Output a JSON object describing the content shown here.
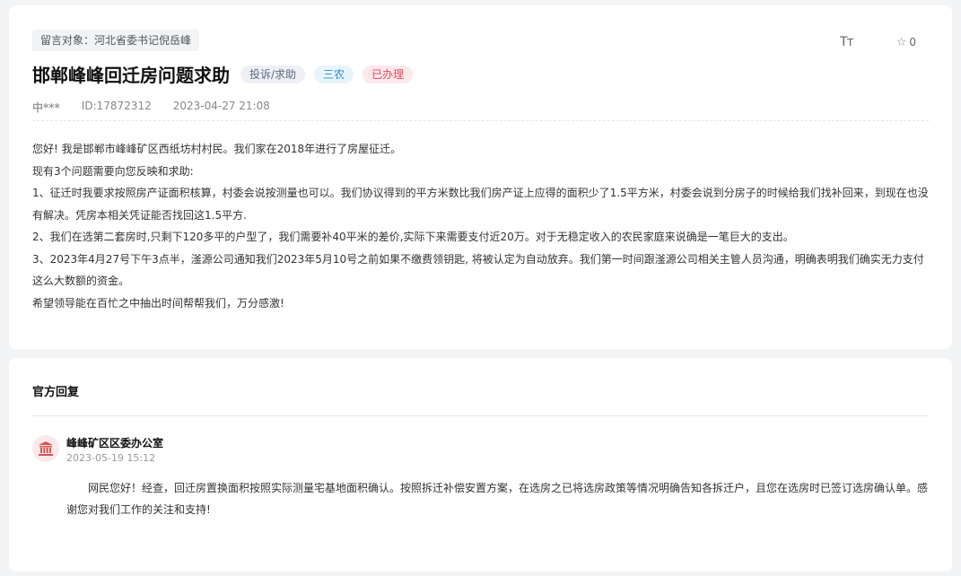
{
  "message": {
    "target_tag": "留言对象：河北省委书记倪岳峰",
    "tools": {
      "font_size_icon": "Tт",
      "star_count": "0",
      "star_icon": "star-outline"
    },
    "title": "邯郸峰峰回迁房问题求助",
    "tags": {
      "type": "投诉/求助",
      "category": "三农",
      "status": "已办理"
    },
    "tag_colors": {
      "type": "#5b6a85",
      "category": "#2e8ccd",
      "status": "#e04a5c"
    },
    "author": "中***",
    "id": "ID:17872312",
    "time": "2023-04-27 21:08",
    "content": [
      "您好! 我是邯郸市峰峰矿区西纸坊村村民。我们家在2018年进行了房屋征迁。",
      "现有3个问题需要向您反映和求助:",
      "1、征迁时我要求按照房产证面积核算，村委会说按测量也可以。我们协议得到的平方米数比我们房产证上应得的面积少了1.5平方米，村委会说到分房子的时候给我们找补回来，到现在也没有解决。凭房本相关凭证能否找回这1.5平方.",
      "2、我们在选第二套房时,只剩下120多平的户型了，我们需要补40平米的差价,实际下来需要支付近20万。对于无稳定收入的农民家庭来说确是一笔巨大的支出。",
      "3、2023年4月27号下午3点半，滏源公司通知我们2023年5月10号之前如果不缴费领钥匙, 将被认定为自动放弃。我们第一时间跟滏源公司相关主管人员沟通，明确表明我们确实无力支付这么大数额的资金。",
      "希望领导能在百忙之中抽出时间帮帮我们，万分感激!"
    ]
  },
  "reply": {
    "heading": "官方回复",
    "office": "峰峰矿区区委办公室",
    "time": "2023-05-19 15:12",
    "icon": "government-building-icon",
    "text": "网民您好！经查，回迁房置换面积按照实际测量宅基地面积确认。按照拆迁补偿安置方案，在选房之已将选房政策等情况明确告知各拆迁户，且您在选房时已签订选房确认单。感谢您对我们工作的关注和支持!"
  }
}
